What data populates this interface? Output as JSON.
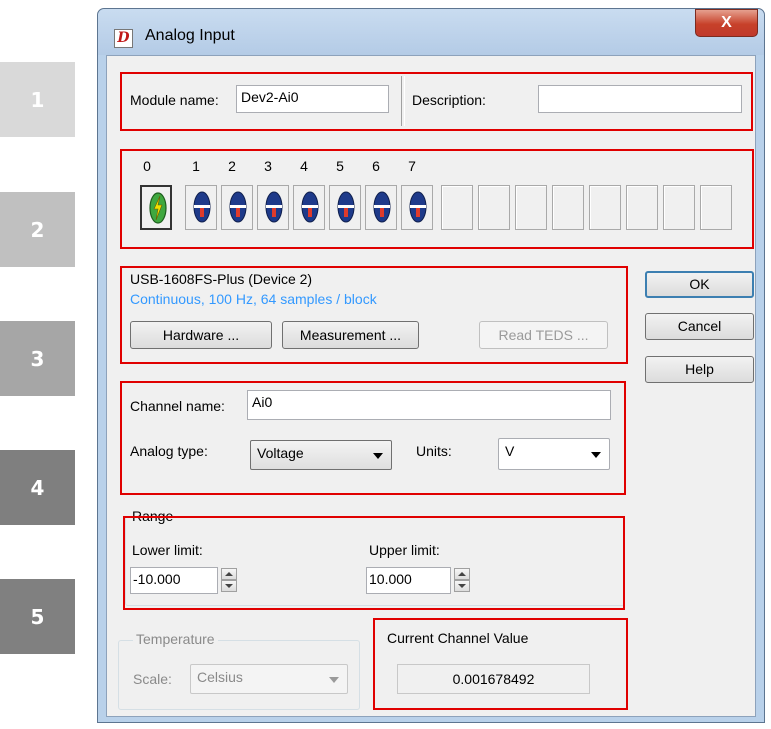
{
  "badges": [
    "1",
    "2",
    "3",
    "4",
    "5"
  ],
  "window": {
    "title": "Analog Input",
    "close_label": "X",
    "app_icon_letter": "D"
  },
  "module": {
    "name_label": "Module name:",
    "name_value": "Dev2-Ai0",
    "description_label": "Description:",
    "description_value": ""
  },
  "channels": {
    "numbers": [
      "0",
      "1",
      "2",
      "3",
      "4",
      "5",
      "6",
      "7"
    ],
    "selected_index": 0
  },
  "device": {
    "name": "USB-1608FS-Plus (Device 2)",
    "status": "Continuous, 100 Hz, 64 samples / block",
    "hardware_button": "Hardware ...",
    "measurement_button": "Measurement ...",
    "read_teds_button": "Read TEDS ..."
  },
  "dialog_buttons": {
    "ok": "OK",
    "cancel": "Cancel",
    "help": "Help"
  },
  "channel": {
    "name_label": "Channel name:",
    "name_value": "Ai0",
    "type_label": "Analog type:",
    "type_value": "Voltage",
    "units_label": "Units:",
    "units_value": "V"
  },
  "range": {
    "title": "Range",
    "lower_label": "Lower limit:",
    "lower_value": "-10.000",
    "upper_label": "Upper limit:",
    "upper_value": "10.000"
  },
  "temperature": {
    "title": "Temperature",
    "scale_label": "Scale:",
    "scale_value": "Celsius"
  },
  "current_value": {
    "title": "Current Channel Value",
    "value": "0.001678492"
  },
  "colors": {
    "highlight_red": "#e00000",
    "status_blue": "#3399ff",
    "badge_1": "#d9d9d9",
    "badge_2": "#c0c0c0",
    "badge_3": "#a6a6a6",
    "badge_4": "#7f7f7f",
    "badge_5": "#808080",
    "connector_blue": "#1e3a8a",
    "connector_green": "#3fa83f"
  }
}
